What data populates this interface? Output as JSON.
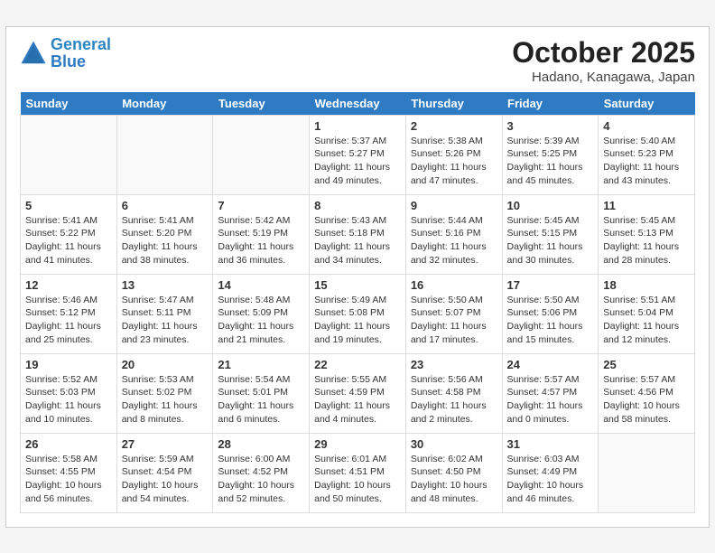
{
  "header": {
    "logo_line1": "General",
    "logo_line2": "Blue",
    "month": "October 2025",
    "location": "Hadano, Kanagawa, Japan"
  },
  "weekdays": [
    "Sunday",
    "Monday",
    "Tuesday",
    "Wednesday",
    "Thursday",
    "Friday",
    "Saturday"
  ],
  "weeks": [
    [
      {
        "day": "",
        "info": ""
      },
      {
        "day": "",
        "info": ""
      },
      {
        "day": "",
        "info": ""
      },
      {
        "day": "1",
        "info": "Sunrise: 5:37 AM\nSunset: 5:27 PM\nDaylight: 11 hours\nand 49 minutes."
      },
      {
        "day": "2",
        "info": "Sunrise: 5:38 AM\nSunset: 5:26 PM\nDaylight: 11 hours\nand 47 minutes."
      },
      {
        "day": "3",
        "info": "Sunrise: 5:39 AM\nSunset: 5:25 PM\nDaylight: 11 hours\nand 45 minutes."
      },
      {
        "day": "4",
        "info": "Sunrise: 5:40 AM\nSunset: 5:23 PM\nDaylight: 11 hours\nand 43 minutes."
      }
    ],
    [
      {
        "day": "5",
        "info": "Sunrise: 5:41 AM\nSunset: 5:22 PM\nDaylight: 11 hours\nand 41 minutes."
      },
      {
        "day": "6",
        "info": "Sunrise: 5:41 AM\nSunset: 5:20 PM\nDaylight: 11 hours\nand 38 minutes."
      },
      {
        "day": "7",
        "info": "Sunrise: 5:42 AM\nSunset: 5:19 PM\nDaylight: 11 hours\nand 36 minutes."
      },
      {
        "day": "8",
        "info": "Sunrise: 5:43 AM\nSunset: 5:18 PM\nDaylight: 11 hours\nand 34 minutes."
      },
      {
        "day": "9",
        "info": "Sunrise: 5:44 AM\nSunset: 5:16 PM\nDaylight: 11 hours\nand 32 minutes."
      },
      {
        "day": "10",
        "info": "Sunrise: 5:45 AM\nSunset: 5:15 PM\nDaylight: 11 hours\nand 30 minutes."
      },
      {
        "day": "11",
        "info": "Sunrise: 5:45 AM\nSunset: 5:13 PM\nDaylight: 11 hours\nand 28 minutes."
      }
    ],
    [
      {
        "day": "12",
        "info": "Sunrise: 5:46 AM\nSunset: 5:12 PM\nDaylight: 11 hours\nand 25 minutes."
      },
      {
        "day": "13",
        "info": "Sunrise: 5:47 AM\nSunset: 5:11 PM\nDaylight: 11 hours\nand 23 minutes."
      },
      {
        "day": "14",
        "info": "Sunrise: 5:48 AM\nSunset: 5:09 PM\nDaylight: 11 hours\nand 21 minutes."
      },
      {
        "day": "15",
        "info": "Sunrise: 5:49 AM\nSunset: 5:08 PM\nDaylight: 11 hours\nand 19 minutes."
      },
      {
        "day": "16",
        "info": "Sunrise: 5:50 AM\nSunset: 5:07 PM\nDaylight: 11 hours\nand 17 minutes."
      },
      {
        "day": "17",
        "info": "Sunrise: 5:50 AM\nSunset: 5:06 PM\nDaylight: 11 hours\nand 15 minutes."
      },
      {
        "day": "18",
        "info": "Sunrise: 5:51 AM\nSunset: 5:04 PM\nDaylight: 11 hours\nand 12 minutes."
      }
    ],
    [
      {
        "day": "19",
        "info": "Sunrise: 5:52 AM\nSunset: 5:03 PM\nDaylight: 11 hours\nand 10 minutes."
      },
      {
        "day": "20",
        "info": "Sunrise: 5:53 AM\nSunset: 5:02 PM\nDaylight: 11 hours\nand 8 minutes."
      },
      {
        "day": "21",
        "info": "Sunrise: 5:54 AM\nSunset: 5:01 PM\nDaylight: 11 hours\nand 6 minutes."
      },
      {
        "day": "22",
        "info": "Sunrise: 5:55 AM\nSunset: 4:59 PM\nDaylight: 11 hours\nand 4 minutes."
      },
      {
        "day": "23",
        "info": "Sunrise: 5:56 AM\nSunset: 4:58 PM\nDaylight: 11 hours\nand 2 minutes."
      },
      {
        "day": "24",
        "info": "Sunrise: 5:57 AM\nSunset: 4:57 PM\nDaylight: 11 hours\nand 0 minutes."
      },
      {
        "day": "25",
        "info": "Sunrise: 5:57 AM\nSunset: 4:56 PM\nDaylight: 10 hours\nand 58 minutes."
      }
    ],
    [
      {
        "day": "26",
        "info": "Sunrise: 5:58 AM\nSunset: 4:55 PM\nDaylight: 10 hours\nand 56 minutes."
      },
      {
        "day": "27",
        "info": "Sunrise: 5:59 AM\nSunset: 4:54 PM\nDaylight: 10 hours\nand 54 minutes."
      },
      {
        "day": "28",
        "info": "Sunrise: 6:00 AM\nSunset: 4:52 PM\nDaylight: 10 hours\nand 52 minutes."
      },
      {
        "day": "29",
        "info": "Sunrise: 6:01 AM\nSunset: 4:51 PM\nDaylight: 10 hours\nand 50 minutes."
      },
      {
        "day": "30",
        "info": "Sunrise: 6:02 AM\nSunset: 4:50 PM\nDaylight: 10 hours\nand 48 minutes."
      },
      {
        "day": "31",
        "info": "Sunrise: 6:03 AM\nSunset: 4:49 PM\nDaylight: 10 hours\nand 46 minutes."
      },
      {
        "day": "",
        "info": ""
      }
    ]
  ]
}
